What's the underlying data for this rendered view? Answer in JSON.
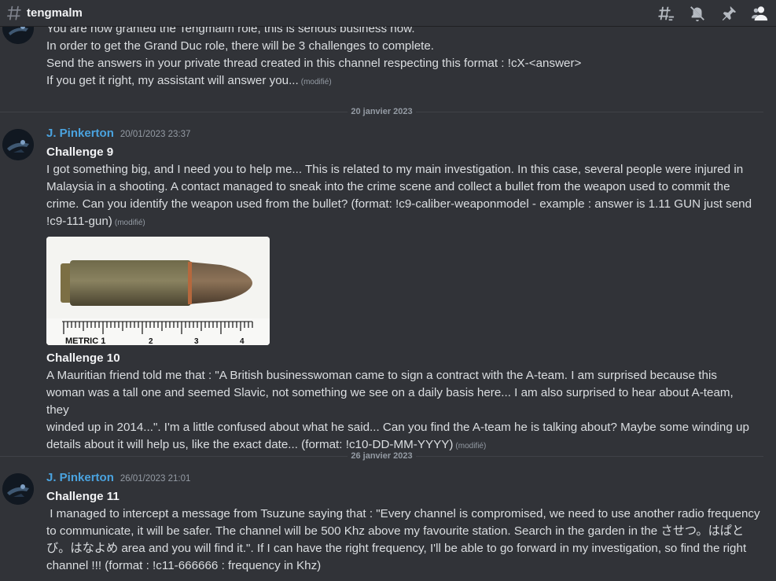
{
  "channel": {
    "name": "tengmalm"
  },
  "header_icons": [
    "threads-icon",
    "notifications-muted-icon",
    "pin-icon",
    "members-icon"
  ],
  "continuation": {
    "lines": [
      "You are now granted the Tengmalm role, this is serious business now.",
      "In order to get the Grand Duc role, there will be 3 challenges to complete.",
      "Send the answers in your private thread created in this channel respecting this format : !cX-<answer>",
      "If you get it right, my assistant will answer you..."
    ],
    "edited": "(modifié)"
  },
  "dividers": [
    "20 janvier 2023",
    "26 janvier 2023"
  ],
  "messages": [
    {
      "author": "J. Pinkerton",
      "timestamp": "20/01/2023 23:37",
      "title": "Challenge 9",
      "lines": [
        "I got something big, and I need you to help me... This is related to my main investigation. In this case, several people were injured in",
        "Malaysia in a shooting. A contact managed to sneak into the crime scene and collect a bullet from the weapon used to commit the",
        "crime. Can you identify the weapon used from the bullet? (format: !c9-caliber-weaponmodel - example : answer is 1.11 GUN just send",
        "!c9-111-gun)"
      ],
      "edited": "(modifié)",
      "attachment_caption": "METRIC 1",
      "ruler_numbers": [
        "2",
        "3",
        "4"
      ],
      "second_title": "Challenge 10",
      "second_lines": [
        "A Mauritian friend told me that : \"A British businesswoman came to sign a contract with the A-team. I am surprised because this",
        "woman was a tall one and seemed Slavic, not something we see on a daily basis here... I am also surprised to hear about A-team, they",
        "winded up in 2014...\". I'm a little confused about what he said... Can you find the A-team he is talking about? Maybe some winding up",
        "details about it will help us, like the exact date... (format: !c10-DD-MM-YYYY)"
      ],
      "second_edited": "(modifié)"
    },
    {
      "author": "J. Pinkerton",
      "timestamp": "26/01/2023 21:01",
      "title": "Challenge 11",
      "lines": [
        " I managed to intercept a message from Tsuzune saying that : \"Every channel is compromised, we need to use another radio frequency",
        "to communicate, it will be safer. The channel will be 500 Khz above my favourite station. Search in the garden in the させつ。はぱと",
        "び。はなよめ area and you will find it.\". If I can have the right frequency, I'll be able to go forward in my investigation, so find the right",
        "channel !!! (format : !c11-666666 : frequency in Khz)"
      ]
    }
  ],
  "colors": {
    "background": "#313338",
    "author": "#4aa3df",
    "text": "#dbdee1",
    "muted": "#949ba4"
  }
}
